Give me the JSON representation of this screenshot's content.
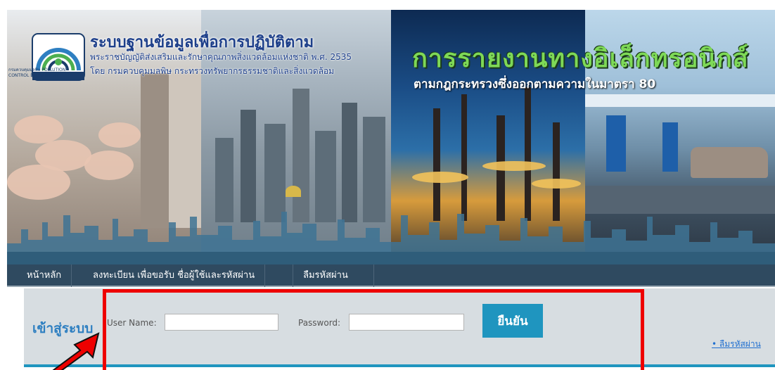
{
  "banner": {
    "logo_caption": "กรมควบคุมมลพิษ POLLUTION CONTROL DEPARTMENT",
    "title_main": "ระบบฐานข้อมูลเพื่อการปฏิบัติตาม",
    "title_sub1": "พระราชบัญญัติส่งเสริมและรักษาคุณภาพสิ่งแวดล้อมแห่งชาติ พ.ศ. 2535",
    "title_sub2": "โดย กรมควบคุมมลพิษ กระทรวงทรัพยากรธรรมชาติและสิ่งแวดล้อม",
    "headline": "การรายงานทางอิเล็กทรอนิกส์",
    "subheadline": "ตามกฎกระทรวงซึ่งออกตามความในมาตรา 80"
  },
  "nav": {
    "home": "หน้าหลัก",
    "register": "ลงทะเบียน เพื่อขอรับ ชื่อผู้ใช้และรหัสผ่าน",
    "forgot": "ลืมรหัสผ่าน"
  },
  "login": {
    "title": "เข้าสู่ระบบ",
    "username_label": "User Name:",
    "username_value": "",
    "password_label": "Password:",
    "password_value": "",
    "submit_label": "ยืนยัน",
    "forgot_link": "• ลืมรหัสผ่าน"
  },
  "colors": {
    "nav_bg": "#2f4a60",
    "accent": "#1f95bf",
    "highlight": "#ee0000",
    "headline": "#7ed957"
  },
  "icons": {
    "logo": "pcd-logo-icon",
    "arrow": "red-arrow-icon"
  }
}
